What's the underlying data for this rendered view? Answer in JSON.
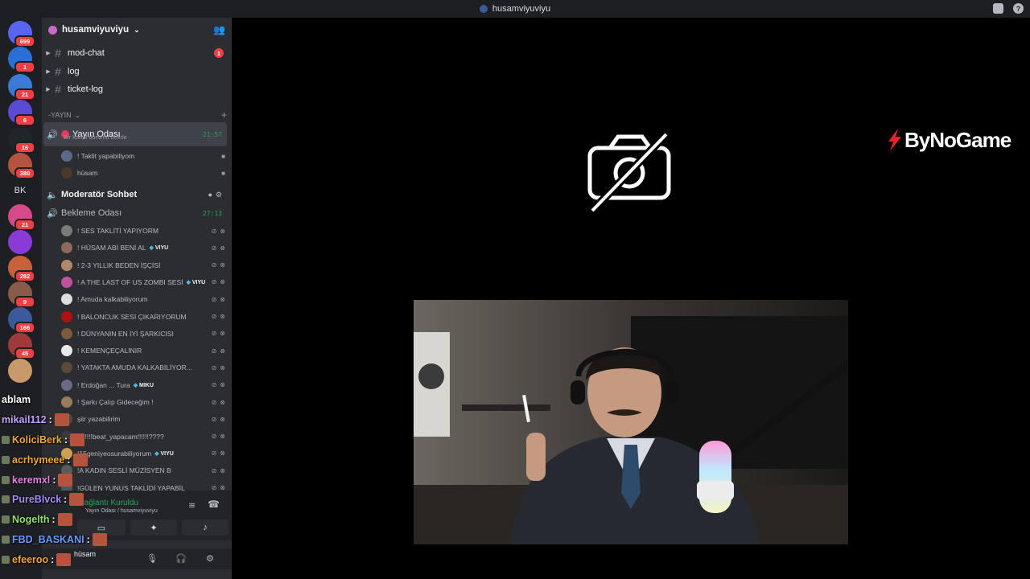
{
  "window": {
    "title": "husamviyuviyu"
  },
  "servers": [
    {
      "name": "discord-home",
      "badge": "699",
      "color": "#5865f2"
    },
    {
      "name": "server-2",
      "badge": "1",
      "color": "#2a6fd6"
    },
    {
      "name": "server-3",
      "badge": "21",
      "color": "#3a7bd5"
    },
    {
      "name": "server-4",
      "badge": "6",
      "color": "#5a4ad6"
    },
    {
      "name": "server-5",
      "badge": "16",
      "color": "#20252a"
    },
    {
      "name": "server-6",
      "badge": "380",
      "color": "#b5533c"
    },
    {
      "name": "server-7",
      "label": "BK",
      "color": "#1e1f22"
    },
    {
      "name": "server-8",
      "badge": "21",
      "color": "#d64a8a"
    },
    {
      "name": "server-9",
      "badge": "",
      "color": "#8a3ad6"
    },
    {
      "name": "server-10",
      "badge": "282",
      "color": "#c8603a"
    },
    {
      "name": "server-11",
      "badge": "9",
      "color": "#8a5a4a"
    },
    {
      "name": "server-12",
      "badge": "166",
      "color": "#3a5a9a"
    },
    {
      "name": "server-13",
      "badge": "45",
      "color": "#a03a3a"
    },
    {
      "name": "server-14",
      "badge": "",
      "color": "#c89a6a"
    }
  ],
  "sidebar": {
    "guild_name": "husamviyuviyu",
    "channels": [
      {
        "label": "mod-chat",
        "unread": "1"
      },
      {
        "label": "log",
        "unread": ""
      },
      {
        "label": "ticket-log",
        "unread": ""
      }
    ],
    "category": "-YAYIN",
    "voice": {
      "room1": {
        "label": "Yayın Odası",
        "timer": "21:57",
        "status": "Bir kanal durumu belirle"
      },
      "room1_members": [
        "! Taklit yapabiliyom",
        "hüsam"
      ],
      "room2": {
        "label": "Moderatör Sohbet"
      },
      "room3": {
        "label": "Bekleme Odası",
        "timer": "27:13"
      },
      "room3_members": [
        {
          "name": "! SES TAKLİTİ YAPIYORM",
          "tag": ""
        },
        {
          "name": "! HÜSAM ABİ BENİ AL",
          "tag": "VIYU"
        },
        {
          "name": "! 2-3 YILLIK BEDEN İŞÇİSİ",
          "tag": ""
        },
        {
          "name": "! A THE LAST OF US ZOMBI SESİ",
          "tag": "VIYU"
        },
        {
          "name": "! Amuda kalkabiliyorum",
          "tag": ""
        },
        {
          "name": "! BALONCUK SESİ ÇIKARIYORUM",
          "tag": ""
        },
        {
          "name": "! DÜNYANIN EN İYİ ŞARKICISI",
          "tag": ""
        },
        {
          "name": "! KEMENÇEÇALINIR",
          "tag": ""
        },
        {
          "name": "! YATAKTA AMUDA KALKABİLİYOR...",
          "tag": ""
        },
        {
          "name": "! Erdoğan ... Tura",
          "tag": "MIKU"
        },
        {
          "name": "! Şarkı Çalıp Gideceğim !",
          "tag": ""
        },
        {
          "name": "şiir yazabilirim",
          "tag": ""
        },
        {
          "name": "!!!!!!!!beat_yapacam!!!!!!????",
          "tag": ""
        },
        {
          "name": "!15geniyeosurabiliyorum",
          "tag": "VIYU"
        },
        {
          "name": "!A KADIN SESLİ MÜZİSYEN B",
          "tag": ""
        },
        {
          "name": "!GÜLEN YUNUS TAKLİDİ YAPABİL",
          "tag": ""
        }
      ]
    }
  },
  "chat_overlay": [
    {
      "user": "ablam",
      "sep": "",
      "color": "#ffffff"
    },
    {
      "user": "mikail112",
      "sep": ":",
      "color": "#c8a0ff"
    },
    {
      "user": "KoliciBerk",
      "sep": ":",
      "color": "#f2a43a"
    },
    {
      "user": "acrhymeee",
      "sep": ":",
      "color": "#f2a43a"
    },
    {
      "user": "keremxl",
      "sep": ":",
      "color": "#e882e8"
    },
    {
      "user": "PureBlvck",
      "sep": ":",
      "color": "#a78bfa"
    },
    {
      "user": "Nogelth",
      "sep": ":",
      "color": "#8fe36a"
    },
    {
      "user": "FBD_BASKANI",
      "sep": ":",
      "color": "#6a9bff"
    },
    {
      "user": "efeeroo",
      "sep": ":",
      "color": "#f2a43a"
    }
  ],
  "voice_panel": {
    "status": "Bağlantı Kuruldu",
    "location": "Yayın Odası / husamviyuviyu"
  },
  "user_panel": {
    "username": "hüsam"
  },
  "main": {
    "brand": "ByNoGame"
  },
  "colors": {
    "accent": "#23a55a",
    "danger": "#f23f43",
    "sidebar": "#2b2d31",
    "rail": "#1e1f22"
  }
}
